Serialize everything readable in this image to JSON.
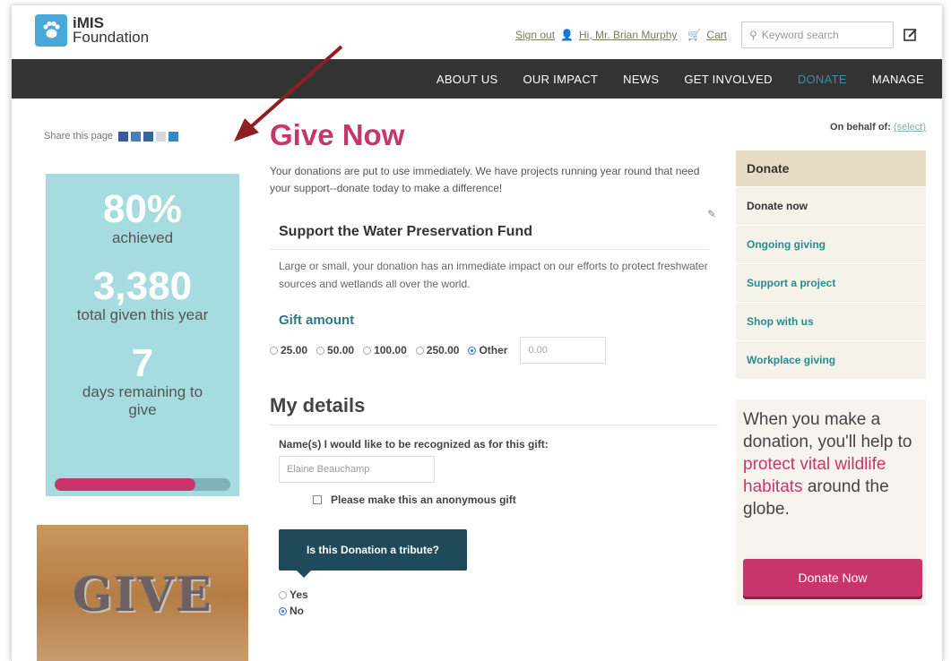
{
  "brand": {
    "name_line1": "iMIS",
    "name_line2": "Foundation"
  },
  "toplinks": {
    "signout": "Sign out",
    "greeting": "Hi, Mr. Brian Murphy",
    "cart": "Cart"
  },
  "search": {
    "placeholder": "Keyword search"
  },
  "nav": [
    "ABOUT US",
    "OUR IMPACT",
    "NEWS",
    "GET INVOLVED",
    "DONATE",
    "MANAGE"
  ],
  "share": {
    "label": "Share this page"
  },
  "stats": {
    "percent": "80%",
    "percent_label": "achieved",
    "total": "3,380",
    "total_label": "total given this year",
    "days": "7",
    "days_label": "days remaining to give",
    "progress": 0.8
  },
  "give_image": {
    "letters": "GIVE"
  },
  "main": {
    "title": "Give Now",
    "intro": "Your donations are put to use immediately. We have projects running year round that need your support--donate today to make a difference!",
    "fund_title": "Support the Water Preservation Fund",
    "fund_desc": "Large or small, your donation has an immediate impact on our efforts to protect freshwater sources and wetlands all over the world.",
    "gift_label": "Gift amount",
    "amounts": [
      "25.00",
      "50.00",
      "100.00",
      "250.00",
      "Other"
    ],
    "selected_amount": "Other",
    "amount_value": "0.00",
    "my_details": "My details",
    "name_label": "Name(s) I would like to be recognized as for this gift:",
    "name_value": "Elaine Beauchamp",
    "anonymous_label": "Please make this an anonymous gift",
    "tribute_label": "Is this Donation a tribute?",
    "tribute_options": [
      "Yes",
      "No"
    ],
    "tribute_selected": "No"
  },
  "behalf": {
    "label": "On behalf of:",
    "link": "(select)"
  },
  "sidenav": {
    "heading": "Donate",
    "items": [
      "Donate now",
      "Ongoing giving",
      "Support a project",
      "Shop with us",
      "Workplace giving"
    ]
  },
  "promo": {
    "text1": "When you make a donation, you'll help to ",
    "highlight": "protect vital wildlife habitats",
    "text2": " around the globe."
  },
  "donate_button": "Donate Now",
  "colors": {
    "accent": "#c7356a",
    "teal": "#2a8a8f",
    "nav_bg": "#333333",
    "stats_bg": "#a6dbe0"
  }
}
